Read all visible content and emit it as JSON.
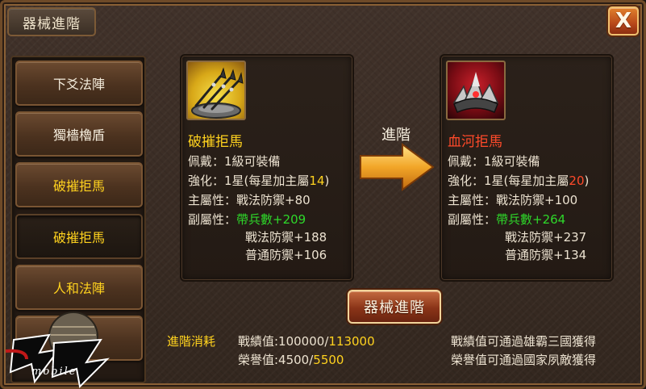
{
  "window": {
    "title": "器械進階",
    "close_label": "X"
  },
  "sidebar": {
    "items": [
      {
        "label": "下爻法陣",
        "color": "white"
      },
      {
        "label": "獨檣櫓盾",
        "color": "white"
      },
      {
        "label": "破摧拒馬",
        "color": "yellow"
      },
      {
        "label": "破摧拒馬",
        "color": "yellow",
        "selected": true
      },
      {
        "label": "人和法陣",
        "color": "yellow"
      }
    ]
  },
  "current": {
    "name": "破摧拒馬",
    "icon": "triple-spear-icon",
    "equip_prefix": "佩戴：",
    "equip_value": "1級可裝備",
    "enhance_prefix": "強化：1星(每星加主屬",
    "enhance_num": "14",
    "enhance_suffix": ")",
    "main_attr": "主屬性：戰法防禦+80",
    "sub_label": "副屬性：",
    "sub1": "帶兵數+209",
    "sub2": "戰法防禦+188",
    "sub3": "普通防禦+106"
  },
  "next": {
    "name": "血河拒馬",
    "icon": "red-spike-barricade-icon",
    "equip_prefix": "佩戴：",
    "equip_value": "1級可裝備",
    "enhance_prefix": "強化：1星(每星加主屬",
    "enhance_num": "20",
    "enhance_suffix": ")",
    "main_attr": "主屬性：戰法防禦+100",
    "sub_label": "副屬性：",
    "sub1": "帶兵數+264",
    "sub2": "戰法防禦+237",
    "sub3": "普通防禦+134"
  },
  "arrow": {
    "label": "進階",
    "icon": "right-arrow-icon"
  },
  "upgrade_button": "器械進階",
  "cost": {
    "label": "進階消耗",
    "merit_prefix": "戰績值:100000/",
    "merit_need": "113000",
    "honor_prefix": "榮譽值:4500/",
    "honor_need": "5500"
  },
  "hints": {
    "merit": "戰績值可通過雄霸三國獲得",
    "honor": "榮譽值可通過國家夙敵獲得"
  },
  "logo": {
    "text": "mobile"
  },
  "colors": {
    "highlight_yellow": "#ffd21e",
    "highlight_red": "#ff4a2a",
    "bonus_green": "#2ed82a"
  }
}
